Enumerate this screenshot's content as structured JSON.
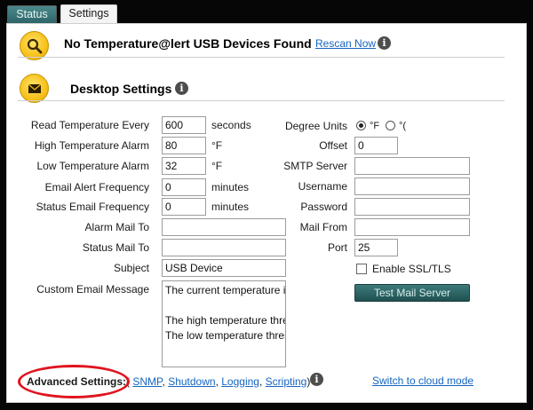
{
  "tabs": [
    {
      "label": "Status"
    },
    {
      "label": "Settings"
    }
  ],
  "header": {
    "title": "No Temperature@lert USB Devices Found",
    "rescan": "Rescan Now",
    "info": "i"
  },
  "desktop": {
    "title": "Desktop Settings",
    "info": "i"
  },
  "left_fields": {
    "read_temp": {
      "label": "Read Temperature Every",
      "value": "600",
      "unit": "seconds"
    },
    "high_alarm": {
      "label": "High Temperature Alarm",
      "value": "80",
      "unit": "°F"
    },
    "low_alarm": {
      "label": "Low Temperature Alarm",
      "value": "32",
      "unit": "°F"
    },
    "email_freq": {
      "label": "Email Alert Frequency",
      "value": "0",
      "unit": "minutes"
    },
    "status_freq": {
      "label": "Status Email Frequency",
      "value": "0",
      "unit": "minutes"
    },
    "alarm_to": {
      "label": "Alarm Mail To",
      "value": ""
    },
    "status_to": {
      "label": "Status Mail To",
      "value": ""
    },
    "subject": {
      "label": "Subject",
      "value": "USB Device"
    },
    "custom_msg": {
      "label": "Custom Email Message",
      "value": "The current temperature i\n\nThe high temperature thre\nThe low temperature thres"
    }
  },
  "right_fields": {
    "degree": {
      "label": "Degree Units",
      "opt_f": "°F",
      "opt_c": "°(",
      "selected": "F"
    },
    "offset": {
      "label": "Offset",
      "value": "0"
    },
    "smtp": {
      "label": "SMTP Server",
      "value": ""
    },
    "username": {
      "label": "Username",
      "value": ""
    },
    "password": {
      "label": "Password",
      "value": ""
    },
    "mail_from": {
      "label": "Mail From",
      "value": ""
    },
    "port": {
      "label": "Port",
      "value": "25"
    },
    "ssl": {
      "label": "Enable SSL/TLS",
      "checked": false
    },
    "test_button": "Test Mail Server"
  },
  "advanced": {
    "label": "Advanced Settings:",
    "open": "(",
    "snmp": "SNMP",
    "shutdown": "Shutdown",
    "logging": "Logging",
    "scripting": "Scripting",
    "close": ")",
    "sep": ","
  },
  "cloud_link": "Switch to cloud mode",
  "colors": {
    "accent_teal": "#2e6467",
    "link_blue": "#1565c0",
    "highlight_red": "#e0141f",
    "icon_yellow": "#f7c11a"
  }
}
